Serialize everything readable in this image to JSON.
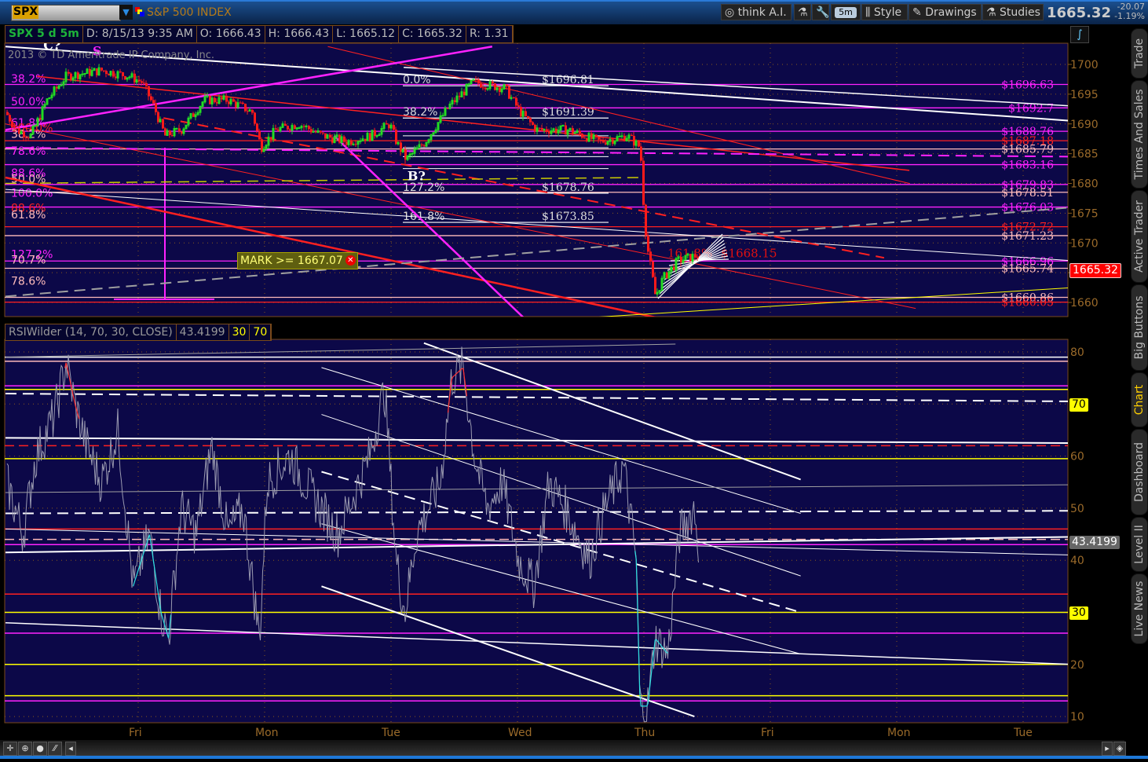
{
  "toolbar": {
    "symbol": "SPX",
    "symbol_name": "S&P 500 INDEX",
    "think_ai": "think A.I.",
    "interval": "5m",
    "style": "Style",
    "drawings": "Drawings",
    "studies": "Studies",
    "last": "1665.32",
    "change": "-20.07",
    "change_pct": "-1.19%"
  },
  "info": {
    "title": "SPX 5 d 5m",
    "date": "D: 8/15/13 9:35 AM",
    "open": "O: 1666.43",
    "high": "H: 1666.43",
    "low": "L: 1665.12",
    "close": "C: 1665.32",
    "range": "R: 1.31"
  },
  "copyright": "2013 © TD Ameritrade IP Company, Inc.",
  "mark": {
    "label": "MARK >= 1667.07",
    "close_icon": "close-icon"
  },
  "rsi_header": {
    "name": "RSIWilder (14, 70, 30, CLOSE)",
    "value": "43.4199",
    "lower": "30",
    "upper": "70"
  },
  "side_tabs": [
    "Trade",
    "Times And Sales",
    "Active Trader",
    "Big Buttons",
    "Chart",
    "Dashboard",
    "Level II",
    "Live News"
  ],
  "active_side_tab": "Chart",
  "colors": {
    "bg": "#0c0848",
    "up": "#22dd22",
    "down": "#ff1a1a",
    "magenta": "#ff22ff",
    "red": "#ff2020",
    "pink": "#ffbbbb",
    "yellow": "#ffff00",
    "white": "#ffffff",
    "gray": "#a0a0a0"
  },
  "chart_data": [
    {
      "type": "candlestick",
      "title": "SPX 5 d 5m",
      "x_unit": "trading day offset (0 = Fri)",
      "xlabels": [
        {
          "day": 0,
          "label": "Fri"
        },
        {
          "day": 1,
          "label": "Mon"
        },
        {
          "day": 2,
          "label": "Tue"
        },
        {
          "day": 3,
          "label": "Wed"
        },
        {
          "day": 4,
          "label": "Thu"
        },
        {
          "day": 5,
          "label": "Fri"
        },
        {
          "day": 6,
          "label": "Mon"
        },
        {
          "day": 7,
          "label": "Tue"
        }
      ],
      "ylim": [
        1657,
        1703
      ],
      "yticks": [
        1660,
        1665,
        1670,
        1675,
        1680,
        1685,
        1690,
        1695,
        1700
      ],
      "price_path": [
        [
          -1.05,
          1692
        ],
        [
          -0.97,
          1689
        ],
        [
          -0.85,
          1688
        ],
        [
          -0.72,
          1694
        ],
        [
          -0.57,
          1698
        ],
        [
          -0.29,
          1699
        ],
        [
          -0.07,
          1698
        ],
        [
          0.03,
          1697
        ],
        [
          0.12,
          1693
        ],
        [
          0.21,
          1688
        ],
        [
          0.34,
          1689
        ],
        [
          0.52,
          1694
        ],
        [
          0.71,
          1694
        ],
        [
          0.9,
          1692
        ],
        [
          0.97,
          1686
        ],
        [
          1.09,
          1689
        ],
        [
          1.27,
          1690
        ],
        [
          1.46,
          1688
        ],
        [
          1.65,
          1687
        ],
        [
          1.84,
          1688
        ],
        [
          1.99,
          1690
        ],
        [
          2.04,
          1687
        ],
        [
          2.12,
          1684
        ],
        [
          2.27,
          1687
        ],
        [
          2.46,
          1693
        ],
        [
          2.65,
          1697
        ],
        [
          2.9,
          1696
        ],
        [
          3.02,
          1692
        ],
        [
          3.15,
          1689
        ],
        [
          3.4,
          1689
        ],
        [
          3.65,
          1687
        ],
        [
          3.87,
          1688
        ],
        [
          3.97,
          1686
        ],
        [
          3.99,
          1678
        ],
        [
          4.02,
          1670
        ],
        [
          4.09,
          1661
        ],
        [
          4.15,
          1664
        ],
        [
          4.27,
          1667
        ],
        [
          4.44,
          1668
        ]
      ],
      "last_price": "1665.32",
      "right_levels": [
        {
          "label": "$1696.63",
          "price": 1696.63,
          "color": "#ff22ff"
        },
        {
          "label": "$1692.7",
          "price": 1692.7,
          "color": "#ff22ff"
        },
        {
          "label": "$1688.76",
          "price": 1688.76,
          "color": "#ff22ff"
        },
        {
          "label": "$1687.18",
          "price": 1687.18,
          "color": "#ff2020"
        },
        {
          "label": "$1685.79",
          "price": 1685.79,
          "color": "#ffbbbb"
        },
        {
          "label": "$1683.16",
          "price": 1683.16,
          "color": "#ff22ff"
        },
        {
          "label": "$1679.83",
          "price": 1679.83,
          "color": "#ff22ff"
        },
        {
          "label": "$1678.51",
          "price": 1678.51,
          "color": "#ffbbbb"
        },
        {
          "label": "$1676.03",
          "price": 1676.03,
          "color": "#ff22ff"
        },
        {
          "label": "$1672.72",
          "price": 1672.72,
          "color": "#ff2020"
        },
        {
          "label": "$1671.23",
          "price": 1671.23,
          "color": "#ffbbbb"
        },
        {
          "label": "$1666.96",
          "price": 1666.96,
          "color": "#ff22ff"
        },
        {
          "label": "$1665.74",
          "price": 1665.74,
          "color": "#ffbbbb"
        },
        {
          "label": "$1660.86",
          "price": 1660.86,
          "color": "#ffbbbb"
        },
        {
          "label": "$1660.05",
          "price": 1660.05,
          "color": "#ff2020"
        }
      ],
      "left_fibs": [
        {
          "label": "38.2%",
          "price": 1697.6,
          "color": "#ff22ff"
        },
        {
          "label": "50.0%",
          "price": 1693.8,
          "color": "#ff22ff"
        },
        {
          "label": "61.8%",
          "price": 1690.2,
          "color": "#ff22ff"
        },
        {
          "label": "100.0%",
          "price": 1689.4,
          "color": "#ff2020"
        },
        {
          "label": "38.2%",
          "price": 1688.3,
          "color": "#ffbbbb"
        },
        {
          "label": "78.6%",
          "price": 1685.5,
          "color": "#ff22ff"
        },
        {
          "label": "88.6%",
          "price": 1681.8,
          "color": "#ff22ff"
        },
        {
          "label": "50.0%",
          "price": 1680.8,
          "color": "#ffbbbb"
        },
        {
          "label": "100.0%",
          "price": 1678.4,
          "color": "#ff22ff"
        },
        {
          "label": "88.6%",
          "price": 1675.9,
          "color": "#ff2020"
        },
        {
          "label": "61.8%",
          "price": 1674.8,
          "color": "#ffbbbb"
        },
        {
          "label": "127.2%",
          "price": 1668.1,
          "color": "#ff22ff"
        },
        {
          "label": "70.7%",
          "price": 1667.2,
          "color": "#ffbbbb"
        },
        {
          "label": "78.6%",
          "price": 1663.6,
          "color": "#ffbbbb"
        }
      ],
      "fib_retracement": [
        {
          "pct": "0.0%",
          "value": "$1696.81",
          "price": 1696.81
        },
        {
          "pct": "38.2%",
          "value": "$1691.39",
          "price": 1691.39
        },
        {
          "pct": "127.2%",
          "value": "$1678.76",
          "price": 1678.76
        },
        {
          "pct": "161.8%",
          "value": "$1673.85",
          "price": 1673.85
        }
      ],
      "fib_extension": {
        "pct": "161.8%",
        "value": "$1668.15",
        "price": 1668.15
      },
      "annotations": [
        {
          "text": "C?",
          "day": -0.75,
          "price": 1702.5,
          "color": "#ffffff"
        },
        {
          "text": "S",
          "day": -0.36,
          "price": 1701.5,
          "color": "#ff22ff"
        },
        {
          "text": "B?",
          "day": 2.13,
          "price": 1680.5,
          "color": "#ffffff"
        }
      ],
      "trendlines": [
        {
          "from": [
            -1.05,
            1703
          ],
          "to": [
            7.4,
            1690.5
          ],
          "color": "#ffffff",
          "w": 2
        },
        {
          "from": [
            2.1,
            1699.5
          ],
          "to": [
            7.4,
            1693
          ],
          "color": "#ffffff",
          "w": 1.5
        },
        {
          "from": [
            -1.05,
            1679
          ],
          "to": [
            7.4,
            1667
          ],
          "color": "#ffffff",
          "w": 1
        },
        {
          "from": [
            -0.8,
            1698
          ],
          "to": [
            6.1,
            1682.2
          ],
          "color": "#ff2020",
          "w": 1.5
        },
        {
          "from": [
            1.5,
            1703
          ],
          "to": [
            6.1,
            1680
          ],
          "color": "#ff2020",
          "w": 1
        },
        {
          "from": [
            -1.05,
            1681
          ],
          "to": [
            4.2,
            1657
          ],
          "color": "#ff2020",
          "w": 2.5
        },
        {
          "from": [
            -1.05,
            1690
          ],
          "to": [
            6.15,
            1659
          ],
          "color": "#ff2020",
          "w": 1
        },
        {
          "from": [
            0.2,
            1691
          ],
          "to": [
            5.9,
            1667.5
          ],
          "color": "#ff2020",
          "w": 2,
          "dash": true
        },
        {
          "from": [
            -1.05,
            1689
          ],
          "to": [
            2.8,
            1703
          ],
          "color": "#ff22ff",
          "w": 2.5
        },
        {
          "from": [
            1.55,
            1688
          ],
          "to": [
            3.07,
            1657
          ],
          "color": "#ff22ff",
          "w": 2.5
        },
        {
          "from": [
            -1.05,
            1661
          ],
          "to": [
            7.4,
            1676
          ],
          "color": "#a0a0a0",
          "w": 2,
          "dash": true
        },
        {
          "from": [
            3.6,
            1657.5
          ],
          "to": [
            7.4,
            1662.5
          ],
          "color": "#ffff00",
          "w": 1
        },
        {
          "from": [
            -1.05,
            1686
          ],
          "to": [
            7.4,
            1684.5
          ],
          "color": "#ff22ff",
          "w": 2,
          "dash": true
        },
        {
          "from": [
            -1.05,
            1680
          ],
          "to": [
            4.0,
            1681
          ],
          "color": "#cccc00",
          "w": 1.5,
          "dash": true
        }
      ]
    },
    {
      "type": "line",
      "title": "RSIWilder (14, 70, 30, CLOSE)",
      "ylim": [
        8,
        82
      ],
      "yticks": [
        10,
        20,
        30,
        40,
        50,
        60,
        70,
        80
      ],
      "value": "43.4199",
      "overbought": "70",
      "oversold": "30",
      "rsi_path": [
        [
          -1.04,
          55
        ],
        [
          -0.91,
          45
        ],
        [
          -0.81,
          60
        ],
        [
          -0.66,
          68
        ],
        [
          -0.57,
          78
        ],
        [
          -0.5,
          70
        ],
        [
          -0.41,
          62
        ],
        [
          -0.29,
          55
        ],
        [
          -0.16,
          65
        ],
        [
          -0.04,
          35
        ],
        [
          0.09,
          45
        ],
        [
          0.18,
          30
        ],
        [
          0.24,
          25
        ],
        [
          0.34,
          50
        ],
        [
          0.46,
          45
        ],
        [
          0.58,
          62
        ],
        [
          0.71,
          45
        ],
        [
          0.83,
          50
        ],
        [
          0.96,
          25
        ],
        [
          1.02,
          55
        ],
        [
          1.2,
          60
        ],
        [
          1.39,
          52
        ],
        [
          1.58,
          45
        ],
        [
          1.83,
          60
        ],
        [
          1.95,
          73
        ],
        [
          2.04,
          40
        ],
        [
          2.11,
          30
        ],
        [
          2.2,
          45
        ],
        [
          2.39,
          55
        ],
        [
          2.48,
          75
        ],
        [
          2.57,
          77
        ],
        [
          2.66,
          60
        ],
        [
          2.76,
          50
        ],
        [
          2.88,
          55
        ],
        [
          3.01,
          40
        ],
        [
          3.13,
          35
        ],
        [
          3.25,
          55
        ],
        [
          3.38,
          50
        ],
        [
          3.57,
          40
        ],
        [
          3.69,
          50
        ],
        [
          3.84,
          58
        ],
        [
          3.94,
          40
        ],
        [
          3.97,
          12
        ],
        [
          4.03,
          12
        ],
        [
          4.09,
          25
        ],
        [
          4.19,
          22
        ],
        [
          4.28,
          45
        ],
        [
          4.4,
          50
        ],
        [
          4.43,
          43.4
        ]
      ],
      "levels": [
        {
          "v": 79,
          "color": "#ffffff"
        },
        {
          "v": 78.2,
          "color": "#ffbbbb"
        },
        {
          "v": 73.5,
          "color": "#ff22ff"
        },
        {
          "v": 72.8,
          "color": "#ffff00"
        },
        {
          "v": 62,
          "color": "#ff2020",
          "dash": true
        },
        {
          "v": 59.5,
          "color": "#ffff00"
        },
        {
          "v": 46,
          "color": "#ff2020"
        },
        {
          "v": 44,
          "color": "#ffbbbb",
          "dash": true
        },
        {
          "v": 43,
          "color": "#ff22ff"
        },
        {
          "v": 33.5,
          "color": "#ff2020"
        },
        {
          "v": 30,
          "color": "#ffff00"
        },
        {
          "v": 26,
          "color": "#ff22ff"
        },
        {
          "v": 20,
          "color": "#ffff00"
        },
        {
          "v": 14,
          "color": "#ffff00"
        },
        {
          "v": 13,
          "color": "#ff22ff"
        }
      ],
      "trendlines": [
        {
          "from": [
            2.26,
            81.7
          ],
          "to": [
            5.24,
            55.5
          ],
          "color": "#ffffff",
          "w": 2
        },
        {
          "from": [
            1.45,
            77
          ],
          "to": [
            5.24,
            49
          ],
          "color": "#ffffff",
          "w": 1
        },
        {
          "from": [
            1.45,
            68
          ],
          "to": [
            5.24,
            37
          ],
          "color": "#ffffff",
          "w": 1
        },
        {
          "from": [
            1.45,
            57
          ],
          "to": [
            5.24,
            30
          ],
          "color": "#ffffff",
          "w": 2,
          "dash": true
        },
        {
          "from": [
            1.45,
            47
          ],
          "to": [
            5.24,
            22
          ],
          "color": "#ffffff",
          "w": 1
        },
        {
          "from": [
            1.45,
            35
          ],
          "to": [
            4.4,
            10
          ],
          "color": "#ffffff",
          "w": 2
        },
        {
          "from": [
            -1.05,
            79
          ],
          "to": [
            4.25,
            81.5
          ],
          "color": "#a0a0a0",
          "w": 1
        },
        {
          "from": [
            -1.05,
            72
          ],
          "to": [
            7.4,
            70.5
          ],
          "color": "#ffffff",
          "w": 2,
          "dash": true
        },
        {
          "from": [
            -1.05,
            63.5
          ],
          "to": [
            7.4,
            62.5
          ],
          "color": "#ffffff",
          "w": 2
        },
        {
          "from": [
            -1.05,
            49
          ],
          "to": [
            7.4,
            49.5
          ],
          "color": "#ffffff",
          "w": 2,
          "dash": true
        },
        {
          "from": [
            -1.05,
            46
          ],
          "to": [
            7.4,
            41
          ],
          "color": "#ffffff",
          "w": 1
        },
        {
          "from": [
            -1.05,
            41.5
          ],
          "to": [
            7.4,
            44.5
          ],
          "color": "#ffffff",
          "w": 2
        },
        {
          "from": [
            -1.05,
            28
          ],
          "to": [
            7.4,
            20
          ],
          "color": "#ffffff",
          "w": 1.5
        },
        {
          "from": [
            -1.05,
            53
          ],
          "to": [
            7.4,
            54.5
          ],
          "color": "#a0a0a0",
          "w": 1
        }
      ]
    }
  ]
}
